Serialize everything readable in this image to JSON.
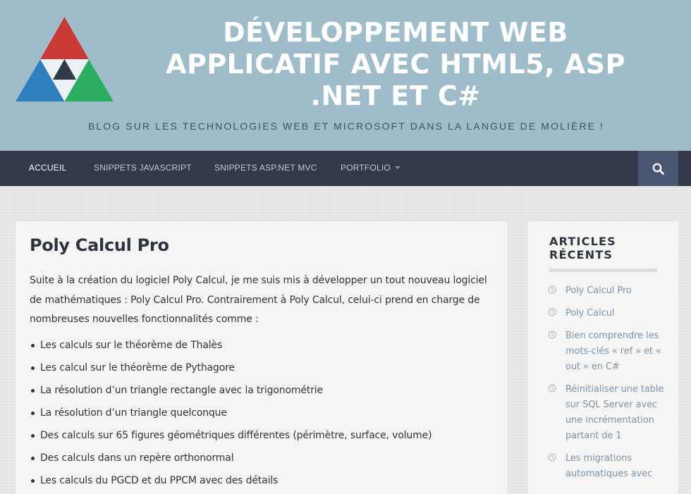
{
  "site": {
    "title": "DÉVELOPPEMENT WEB APPLICATIF AVEC HTML5, ASP .NET ET C#",
    "description": "BLOG SUR LES TECHNOLOGIES WEB ET MICROSOFT DANS LA LANGUE DE MOLIÈRE !"
  },
  "colors": {
    "header": "#9fbccb",
    "nav": "#33394a",
    "search": "#4a5571",
    "link": "#7d94a8"
  },
  "nav": {
    "items": [
      {
        "label": "ACCUEIL"
      },
      {
        "label": "SNIPPETS JAVASCRIPT"
      },
      {
        "label": "SNIPPETS ASP.NET MVC"
      },
      {
        "label": "PORTFOLIO"
      }
    ],
    "search_icon": "search-icon"
  },
  "post": {
    "title": "Poly Calcul Pro",
    "intro": "Suite à la création du logiciel Poly Calcul, je me suis mis à développer un tout nouveau logiciel de mathématiques : Poly Calcul Pro. Contrairement à Poly Calcul, celui-ci prend en charge de nombreuses nouvelles fonctionnalités comme :",
    "features": [
      "Les calculs sur le théorème de Thalès",
      "Les calcul sur le théorème de Pythagore",
      "La résolution d’un triangle rectangle avec la trigonométrie",
      "La résolution d’un triangle quelconque",
      "Des calculs sur 65 figures géométriques différentes (périmètre, surface, volume)",
      "Des calculs dans un repère orthonormal",
      "Les calculs du PGCD et du PPCM avec des détails"
    ]
  },
  "sidebar": {
    "widget_title": "ARTICLES RÉCENTS",
    "recent_posts": [
      "Poly Calcul Pro",
      "Poly Calcul",
      "Bien comprendre les mots-clés « ref » et « out » en C#",
      "Réinitialiser une table sur SQL Server avec une incrémentation partant de 1",
      "Les migrations automatiques avec"
    ]
  }
}
